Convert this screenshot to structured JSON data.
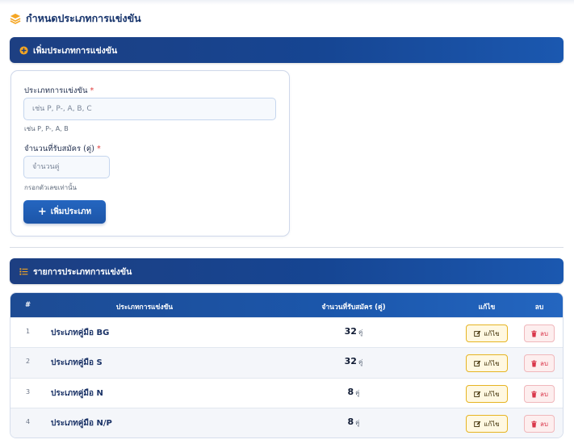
{
  "page": {
    "title": "กำหนดประเภทการแข่งขัน",
    "title_icon": "layers-icon"
  },
  "add_section": {
    "header": "เพิ่มประเภทการแข่งขัน",
    "header_icon": "plus-circle-icon",
    "form": {
      "type_label": "ประเภทการแข่งขัน",
      "type_required": "*",
      "type_value": "",
      "type_placeholder": "เช่น P, P-, A, B, C",
      "type_hint": "เช่น P, P-, A, B",
      "capacity_label": "จำนวนที่รับสมัคร (คู่)",
      "capacity_required": "*",
      "capacity_value": "",
      "capacity_placeholder": "จำนวนคู่",
      "capacity_hint": "กรอกตัวเลขเท่านั้น",
      "submit_label": "เพิ่มประเภท",
      "submit_icon": "plus-icon"
    }
  },
  "list_section": {
    "header": "รายการประเภทการแข่งขัน",
    "header_icon": "list-icon",
    "columns": {
      "index": "#",
      "type": "ประเภทการแข่งขัน",
      "capacity": "จำนวนที่รับสมัคร (คู่)",
      "edit": "แก้ไข",
      "delete": "ลบ"
    },
    "edit_label": "แก้ไข",
    "edit_icon": "edit-icon",
    "delete_label": "ลบ",
    "delete_icon": "trash-icon",
    "unit": "คู่",
    "rows": [
      {
        "index": "1",
        "name": "ประเภทคู่มือ BG",
        "capacity": "32"
      },
      {
        "index": "2",
        "name": "ประเภทคู่มือ S",
        "capacity": "32"
      },
      {
        "index": "3",
        "name": "ประเภทคู่มือ N",
        "capacity": "8"
      },
      {
        "index": "4",
        "name": "ประเภทคู่มือ N/P",
        "capacity": "8"
      }
    ]
  },
  "colors": {
    "header_bar": "#1a4a94",
    "accent": "#f5a623",
    "primary_button": "#1f5db4",
    "edit_button": "#e6b422",
    "delete_button": "#d9364a"
  }
}
